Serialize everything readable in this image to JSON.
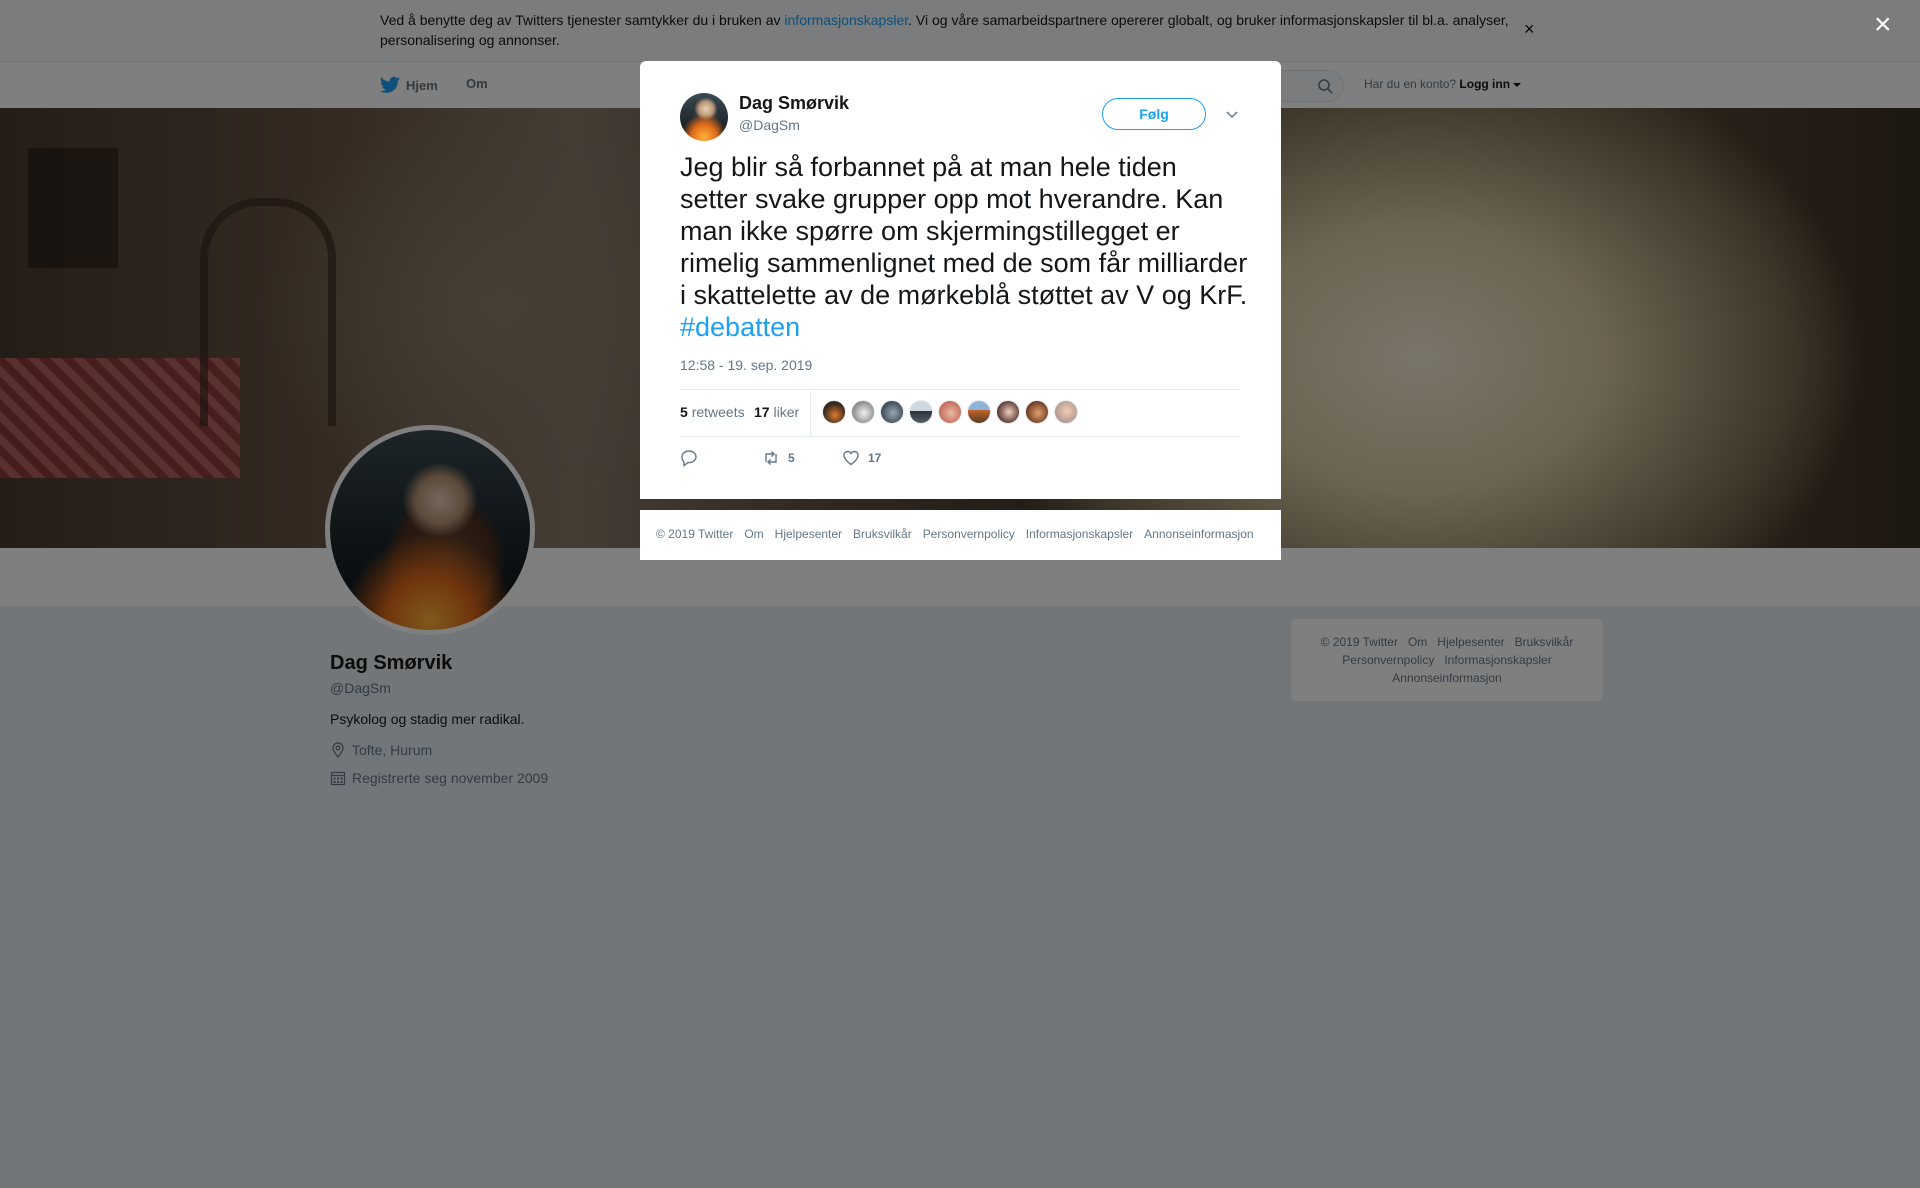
{
  "cookie_banner": {
    "text_before": "Ved å benytte deg av Twitters tjenester samtykker du i bruken av ",
    "link": "informasjonskapsler",
    "text_after": ". Vi og våre samarbeidspartnere opererer globalt, og bruker informasjonskapsler til bl.a. analyser, personalisering og annonser.",
    "close": "×"
  },
  "nav": {
    "home": "Hjem",
    "about": "Om",
    "login_prompt": "Har du en konto?",
    "login": "Logg inn"
  },
  "profile": {
    "name": "Dag Smørvik",
    "handle": "@DagSm",
    "bio": "Psykolog og stadig mer radikal.",
    "location": "Tofte, Hurum",
    "joined": "Registrerte seg november 2009"
  },
  "sidebar_footer": {
    "row1": [
      "© 2019 Twitter",
      "Om",
      "Hjelpesenter",
      "Bruksvilkår"
    ],
    "row2": [
      "Personvernpolicy",
      "Informasjonskapsler"
    ],
    "row3": [
      "Annonseinformasjon"
    ]
  },
  "overlay": {
    "close": "×"
  },
  "tweet": {
    "author_name": "Dag Smørvik",
    "author_handle": "@DagSm",
    "follow_label": "Følg",
    "text": "Jeg blir så forbannet på at man hele tiden setter svake grupper opp mot hverandre. Kan man ikke spørre om skjermingstillegget er rimelig sammenlignet med de som får milliarder i skattelette av de mørkeblå støttet av V og KrF. ",
    "hashtag": "#debatten",
    "timestamp": "12:58 - 19. sep. 2019",
    "retweets_count": "5",
    "retweets_label": "retweets",
    "likes_count": "17",
    "likes_label": "liker",
    "action_retweet_count": "5",
    "action_like_count": "17"
  },
  "modal_footer": [
    "© 2019 Twitter",
    "Om",
    "Hjelpesenter",
    "Bruksvilkår",
    "Personvernpolicy",
    "Informasjonskapsler",
    "Annonseinformasjon"
  ],
  "colors": {
    "accent": "#1da1f2",
    "text": "#14171a",
    "muted": "#657786"
  },
  "icons": [
    "twitter-bird-icon",
    "search-icon",
    "location-icon",
    "calendar-icon",
    "close-icon",
    "chevron-down-icon",
    "reply-icon",
    "retweet-icon",
    "like-icon"
  ]
}
